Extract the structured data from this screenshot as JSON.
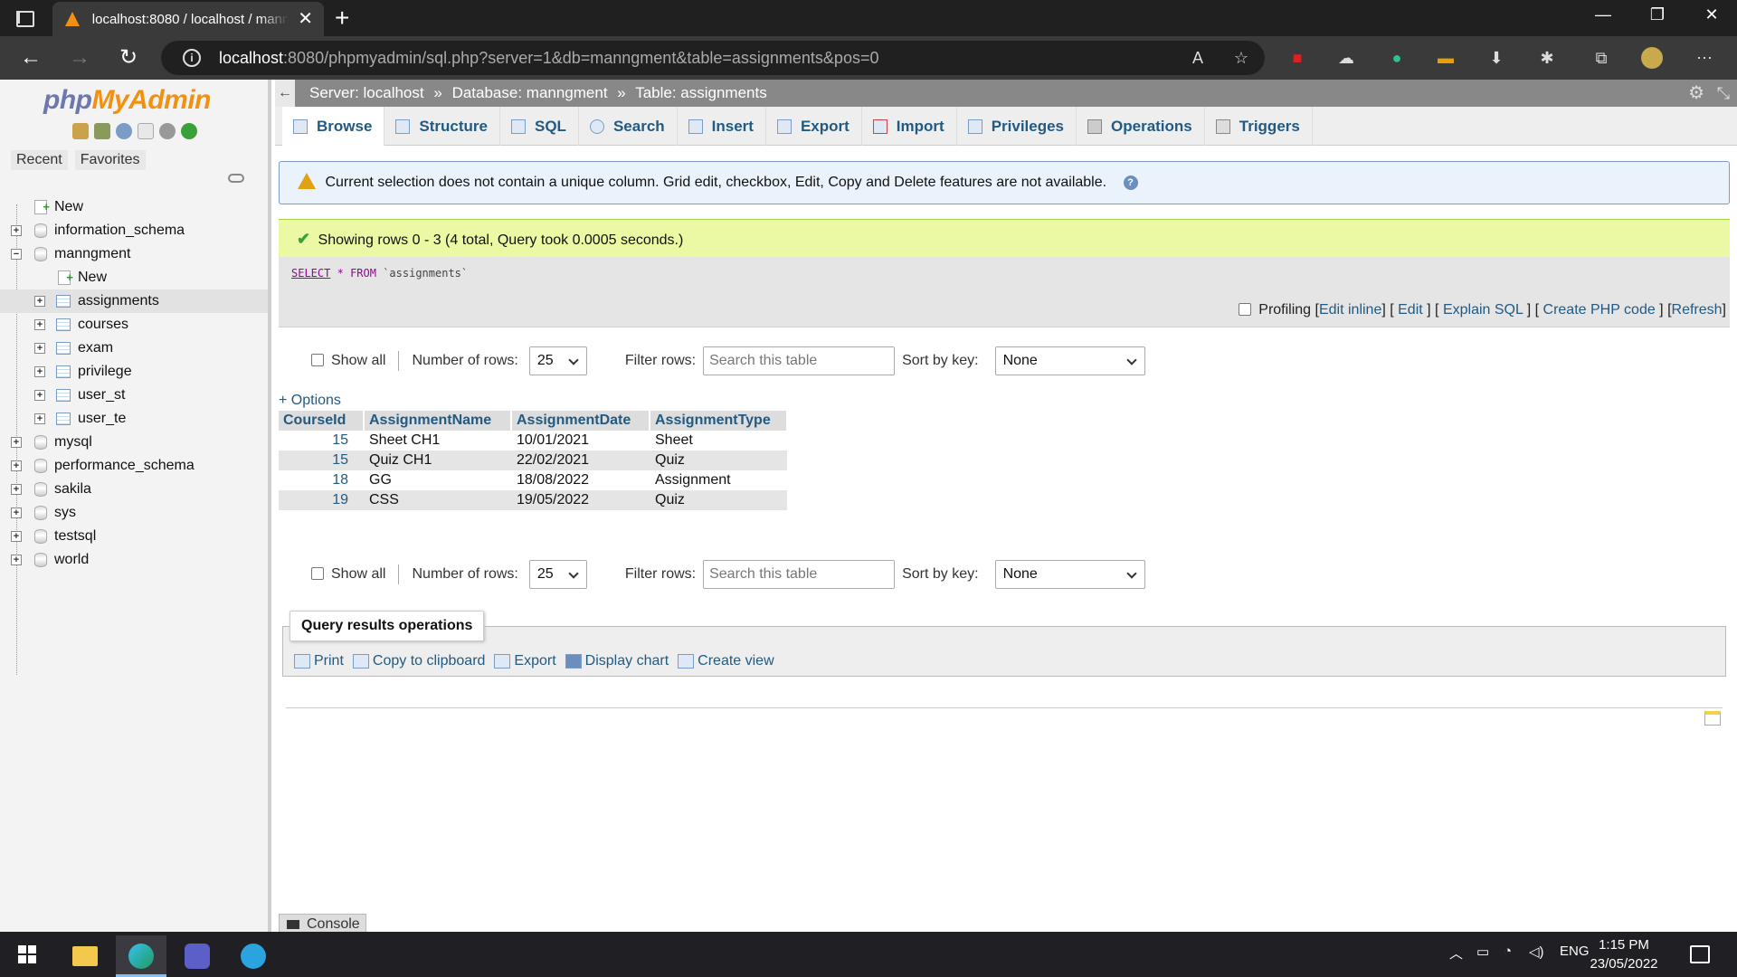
{
  "browser": {
    "tab_title": "localhost:8080 / localhost / manngment",
    "url_host": "localhost",
    "url_rest": ":8080/phpmyadmin/sql.php?server=1&db=manngment&table=assignments&pos=0"
  },
  "sidebar": {
    "logo_php": "php",
    "logo_myadmin": "MyAdmin",
    "tab_recent": "Recent",
    "tab_favorites": "Favorites",
    "tree": {
      "new": "New",
      "information_schema": "information_schema",
      "manngment": "manngment",
      "manngment_new": "New",
      "tables": [
        "assignments",
        "courses",
        "exam",
        "privilege",
        "user_st",
        "user_te"
      ],
      "mysql": "mysql",
      "performance_schema": "performance_schema",
      "sakila": "sakila",
      "sys": "sys",
      "testsql": "testsql",
      "world": "world"
    }
  },
  "breadcrumb": {
    "server": "Server: localhost",
    "database": "Database: manngment",
    "table": "Table: assignments",
    "sep": "»"
  },
  "tabs": [
    "Browse",
    "Structure",
    "SQL",
    "Search",
    "Insert",
    "Export",
    "Import",
    "Privileges",
    "Operations",
    "Triggers"
  ],
  "notice": "Current selection does not contain a unique column. Grid edit, checkbox, Edit, Copy and Delete features are not available.",
  "success": "Showing rows 0 - 3 (4 total, Query took 0.0005 seconds.)",
  "sql": {
    "select": "SELECT",
    "star": "*",
    "from": "FROM",
    "table": "`assignments`"
  },
  "sql_actions": {
    "profiling": "Profiling",
    "edit_inline": "Edit inline",
    "edit": "Edit",
    "explain": "Explain SQL",
    "php_code": "Create PHP code",
    "refresh": "Refresh"
  },
  "nav_controls": {
    "show_all": "Show all",
    "number_of_rows": "Number of rows:",
    "rows_value": "25",
    "filter_rows": "Filter rows:",
    "filter_placeholder": "Search this table",
    "sort_by_key": "Sort by key:",
    "sort_value": "None"
  },
  "options_link": "+ Options",
  "results": {
    "columns": [
      "CourseId",
      "AssignmentName",
      "AssignmentDate",
      "AssignmentType"
    ],
    "rows": [
      [
        "15",
        "Sheet CH1",
        "10/01/2021",
        "Sheet"
      ],
      [
        "15",
        "Quiz CH1",
        "22/02/2021",
        "Quiz"
      ],
      [
        "18",
        "GG",
        "18/08/2022",
        "Assignment"
      ],
      [
        "19",
        "CSS",
        "19/05/2022",
        "Quiz"
      ]
    ]
  },
  "query_ops": {
    "legend": "Query results operations",
    "print": "Print",
    "copy": "Copy to clipboard",
    "export": "Export",
    "chart": "Display chart",
    "view": "Create view"
  },
  "console": "Console",
  "taskbar": {
    "lang": "ENG",
    "time": "1:15 PM",
    "date": "23/05/2022"
  },
  "colors": {
    "link": "#235a81",
    "success_bg": "#ebf8a4",
    "notice_bg": "#eaf3fb"
  }
}
